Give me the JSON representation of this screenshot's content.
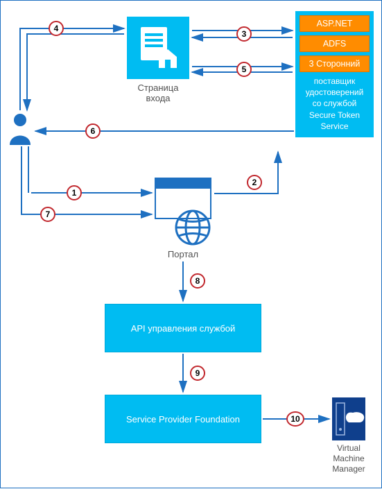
{
  "nodes": {
    "login_page": {
      "label": "Страница входа"
    },
    "idp": {
      "option_aspnet": "ASP.NET",
      "option_adfs": "ADFS",
      "option_thirdparty": "3 Сторонний",
      "description": "поставщик удостоверений со службой Secure Token Service"
    },
    "portal": {
      "label": "Портал"
    },
    "api_management": {
      "label": "API управления службой"
    },
    "spf": {
      "label": "Service Provider Foundation"
    },
    "vmm": {
      "label": "Virtual Machine Manager"
    }
  },
  "steps": {
    "s1": "1",
    "s2": "2",
    "s3": "3",
    "s4": "4",
    "s5": "5",
    "s6": "6",
    "s7": "7",
    "s8": "8",
    "s9": "9",
    "s10": "10"
  },
  "connections": [
    {
      "step": "1",
      "from": "user",
      "to": "portal"
    },
    {
      "step": "2",
      "from": "portal",
      "to": "idp"
    },
    {
      "step": "3",
      "from": "idp",
      "to": "login_page",
      "bidirectional": true
    },
    {
      "step": "4",
      "from": "user",
      "to": "login_page",
      "bidirectional": true
    },
    {
      "step": "5",
      "from": "idp",
      "to": "login_page"
    },
    {
      "step": "6",
      "from": "idp",
      "to": "user"
    },
    {
      "step": "7",
      "from": "user",
      "to": "portal"
    },
    {
      "step": "8",
      "from": "portal",
      "to": "api_management"
    },
    {
      "step": "9",
      "from": "api_management",
      "to": "spf"
    },
    {
      "step": "10",
      "from": "spf",
      "to": "vmm"
    }
  ]
}
